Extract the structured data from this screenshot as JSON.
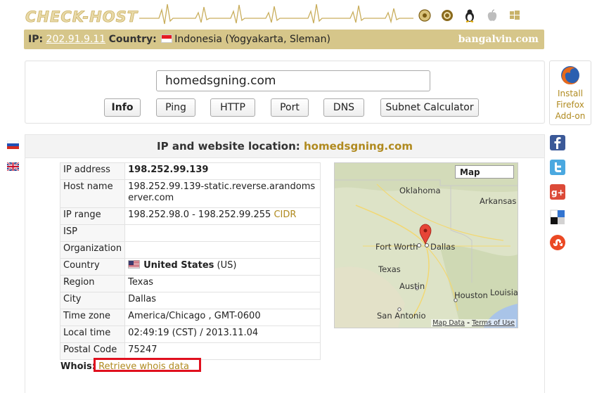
{
  "header": {
    "logo_text": "CHECK-HOST",
    "ip_label": "IP:",
    "ip_value": "202.91.9.11",
    "country_label": "Country:",
    "country_value": "Indonesia (Yogyakarta, Sleman)",
    "site_name": "bangalvin.com"
  },
  "os_icons": [
    "freebsd-icon",
    "ubuntu-icon",
    "linux-icon",
    "apple-icon",
    "windows-icon"
  ],
  "search": {
    "host_value": "homedsgning.com",
    "buttons": [
      "Info",
      "Ping",
      "HTTP",
      "Port",
      "DNS",
      "Subnet Calculator"
    ],
    "active_button": "Info"
  },
  "firefox": {
    "label": "Install Firefox Add-on"
  },
  "panel": {
    "title_prefix": "IP and website location:",
    "title_domain": "homedsgning.com"
  },
  "info": {
    "rows": [
      {
        "key": "IP address",
        "value": "198.252.99.139"
      },
      {
        "key": "Host name",
        "value": "198.252.99.139-static.reverse.arandomserver.com"
      },
      {
        "key": "IP range",
        "value": "198.252.98.0 - 198.252.99.255",
        "extra": "CIDR"
      },
      {
        "key": "ISP",
        "value": ""
      },
      {
        "key": "Organization",
        "value": ""
      },
      {
        "key": "Country",
        "value": "United States",
        "extra": "(US)"
      },
      {
        "key": "Region",
        "value": "Texas"
      },
      {
        "key": "City",
        "value": "Dallas"
      },
      {
        "key": "Time zone",
        "value": "America/Chicago , GMT-0600"
      },
      {
        "key": "Local time",
        "value": "02:49:19 (CST) / 2013.11.04"
      },
      {
        "key": "Postal Code",
        "value": "75247"
      }
    ]
  },
  "whois": {
    "label": "Whois:",
    "link": "Retrieve whois data"
  },
  "map": {
    "button": "Map",
    "places": [
      "Oklahoma",
      "Arkansas",
      "Fort Worth",
      "Dallas",
      "Texas",
      "Austin",
      "Houston",
      "Louisia",
      "San Antonio"
    ],
    "footer_data": "Map Data",
    "footer_sep": "-",
    "footer_terms": "Terms of Use"
  },
  "colors": {
    "accent": "#b08a1f",
    "bar": "#d6c68a",
    "highlight": "#e0101e"
  }
}
